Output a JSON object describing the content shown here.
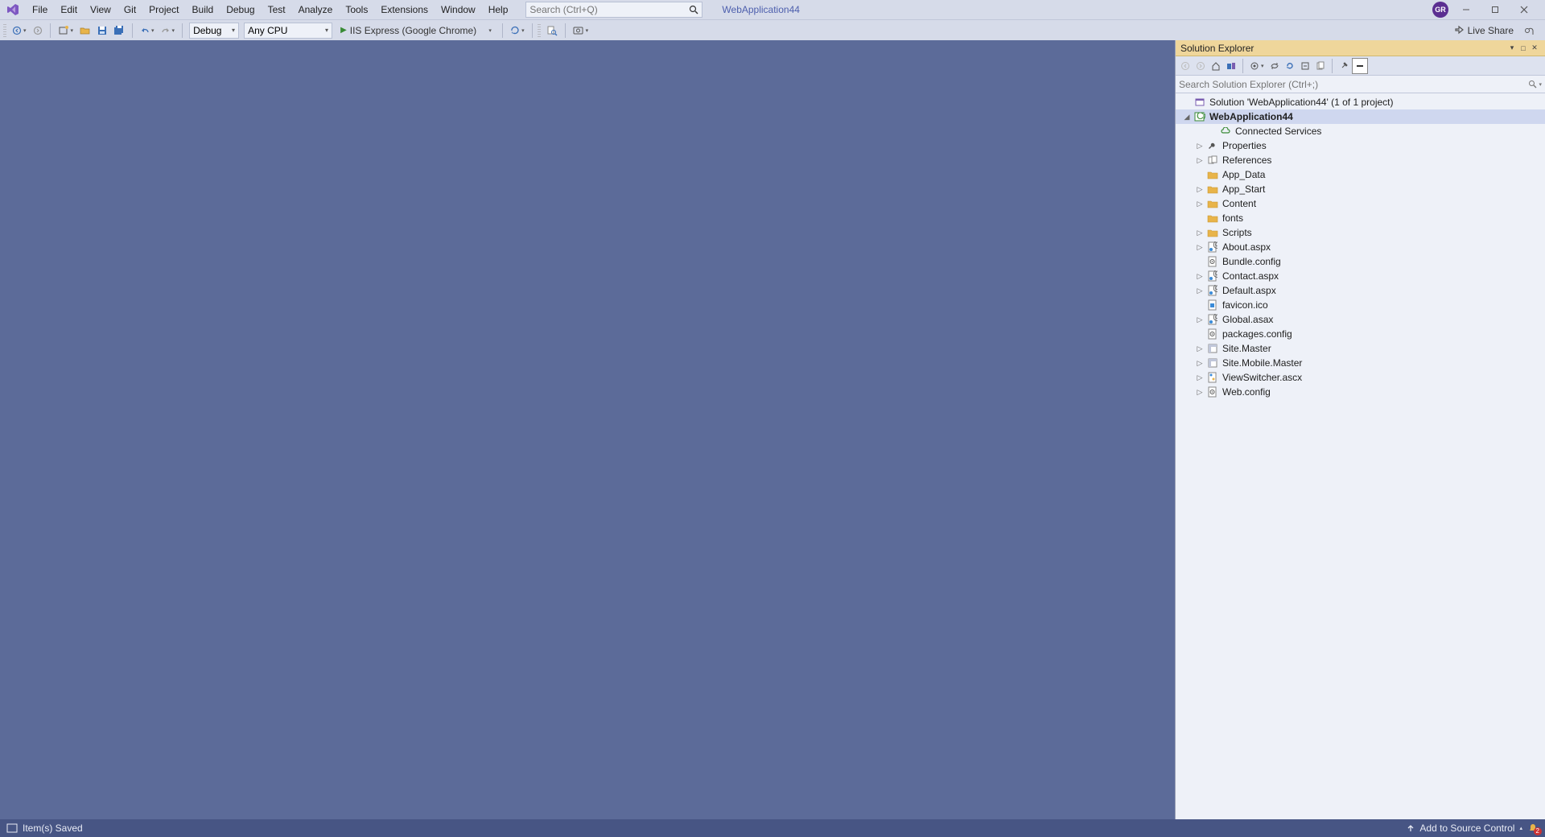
{
  "menu": [
    "File",
    "Edit",
    "View",
    "Git",
    "Project",
    "Build",
    "Debug",
    "Test",
    "Analyze",
    "Tools",
    "Extensions",
    "Window",
    "Help"
  ],
  "search_placeholder": "Search (Ctrl+Q)",
  "project_name": "WebApplication44",
  "avatar_initials": "GR",
  "toolbar": {
    "config": "Debug",
    "platform": "Any CPU",
    "run_label": "IIS Express (Google Chrome)",
    "live_share": "Live Share"
  },
  "explorer": {
    "title": "Solution Explorer",
    "search_placeholder": "Search Solution Explorer (Ctrl+;)",
    "solution_label": "Solution 'WebApplication44' (1 of 1 project)",
    "project_label": "WebApplication44",
    "nodes": [
      {
        "label": "Connected Services",
        "icon": "cloud",
        "expander": ""
      },
      {
        "label": "Properties",
        "icon": "wrench",
        "expander": "▷"
      },
      {
        "label": "References",
        "icon": "ref",
        "expander": "▷"
      },
      {
        "label": "App_Data",
        "icon": "folder",
        "expander": ""
      },
      {
        "label": "App_Start",
        "icon": "folder",
        "expander": "▷"
      },
      {
        "label": "Content",
        "icon": "folder",
        "expander": "▷"
      },
      {
        "label": "fonts",
        "icon": "folder",
        "expander": ""
      },
      {
        "label": "Scripts",
        "icon": "folder",
        "expander": "▷"
      },
      {
        "label": "About.aspx",
        "icon": "aspx",
        "expander": "▷"
      },
      {
        "label": "Bundle.config",
        "icon": "config",
        "expander": ""
      },
      {
        "label": "Contact.aspx",
        "icon": "aspx",
        "expander": "▷"
      },
      {
        "label": "Default.aspx",
        "icon": "aspx",
        "expander": "▷"
      },
      {
        "label": "favicon.ico",
        "icon": "ico",
        "expander": ""
      },
      {
        "label": "Global.asax",
        "icon": "aspx",
        "expander": "▷"
      },
      {
        "label": "packages.config",
        "icon": "config",
        "expander": ""
      },
      {
        "label": "Site.Master",
        "icon": "master",
        "expander": "▷"
      },
      {
        "label": "Site.Mobile.Master",
        "icon": "master",
        "expander": "▷"
      },
      {
        "label": "ViewSwitcher.ascx",
        "icon": "ascx",
        "expander": "▷"
      },
      {
        "label": "Web.config",
        "icon": "config",
        "expander": "▷"
      }
    ]
  },
  "status": {
    "left": "Item(s) Saved",
    "source_control": "Add to Source Control",
    "notifications": "2"
  }
}
